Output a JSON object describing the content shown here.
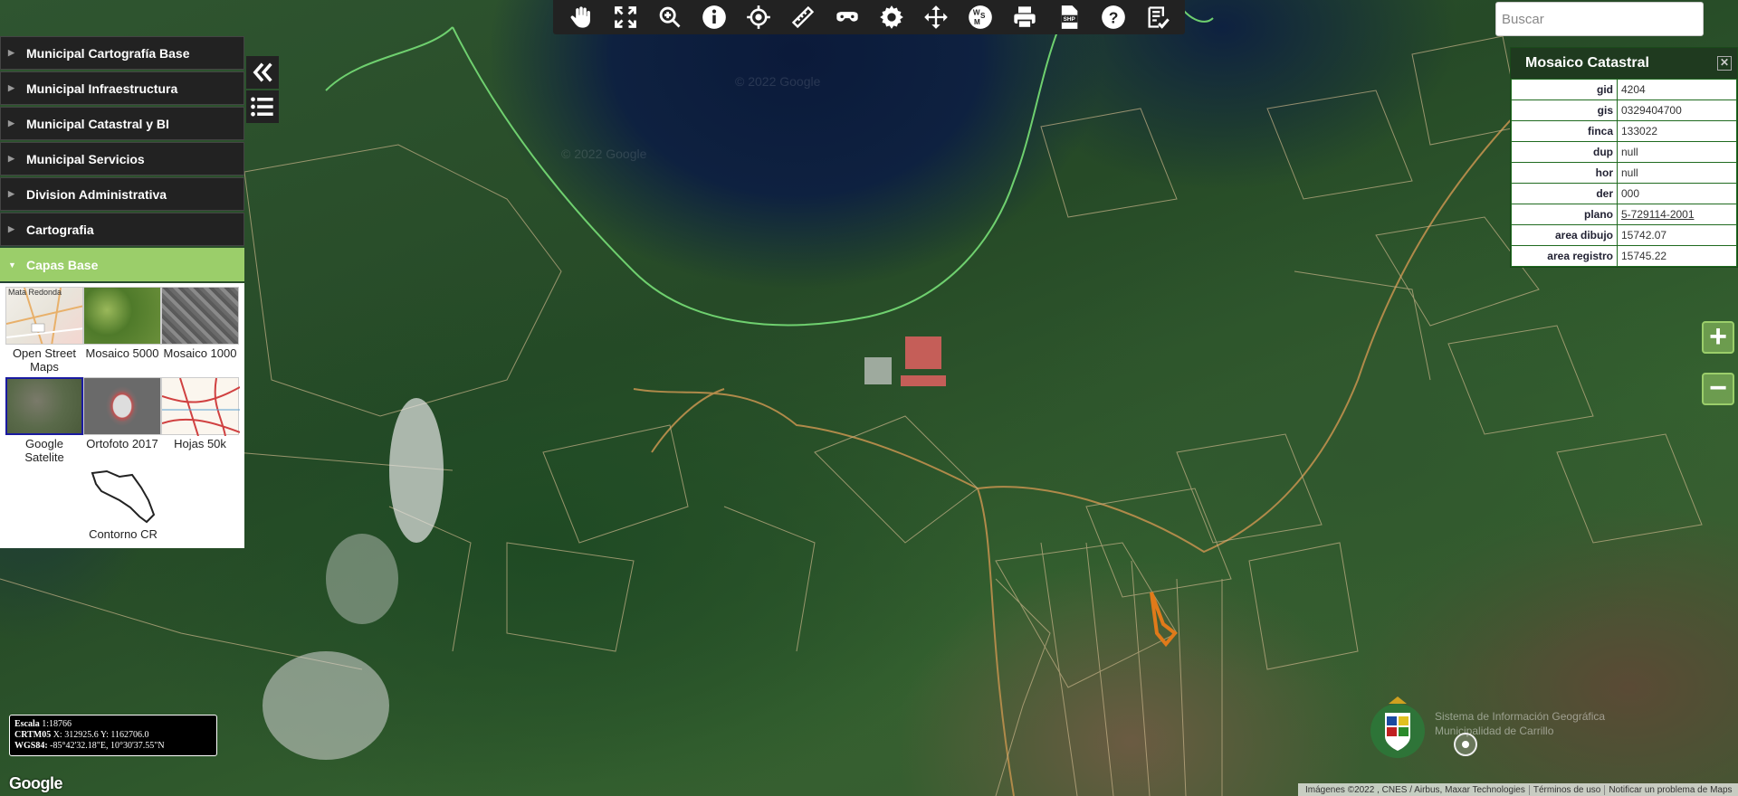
{
  "search": {
    "placeholder": "Buscar"
  },
  "toolbar": {
    "tools": [
      {
        "icon": "hand-icon"
      },
      {
        "icon": "fullscreen-icon"
      },
      {
        "icon": "zoom-in-icon"
      },
      {
        "icon": "info-icon"
      },
      {
        "icon": "crosshair-icon"
      },
      {
        "icon": "ruler-icon"
      },
      {
        "icon": "streetview-icon"
      },
      {
        "icon": "gear-icon"
      },
      {
        "icon": "move-icon"
      },
      {
        "icon": "wms-icon"
      },
      {
        "icon": "print-icon"
      },
      {
        "icon": "shp-file-icon"
      },
      {
        "icon": "help-icon"
      },
      {
        "icon": "checklist-icon"
      }
    ]
  },
  "layers": {
    "items": [
      {
        "label": "Municipal Cartografía Base"
      },
      {
        "label": "Municipal Infraestructura"
      },
      {
        "label": "Municipal Catastral y BI"
      },
      {
        "label": "Municipal Servicios"
      },
      {
        "label": "Division Administrativa"
      },
      {
        "label": "Cartografia"
      },
      {
        "label": "Capas Base"
      }
    ],
    "basemaps": [
      {
        "label": "Open Street Maps"
      },
      {
        "label": "Mosaico 5000"
      },
      {
        "label": "Mosaico 1000"
      },
      {
        "label": "Google Satelite"
      },
      {
        "label": "Ortofoto 2017"
      },
      {
        "label": "Hojas 50k"
      },
      {
        "label": "Contorno CR"
      }
    ],
    "osm_thumb_text": "Mata Redonda"
  },
  "info": {
    "title": "Mosaico Catastral",
    "rows": [
      {
        "key": "gid",
        "value": "4204"
      },
      {
        "key": "gis",
        "value": "0329404700"
      },
      {
        "key": "finca",
        "value": "133022"
      },
      {
        "key": "dup",
        "value": "null"
      },
      {
        "key": "hor",
        "value": "null"
      },
      {
        "key": "der",
        "value": "000"
      },
      {
        "key": "plano",
        "value": "5-729114-2001"
      },
      {
        "key": "area dibujo",
        "value": "15742.07"
      },
      {
        "key": "area registro",
        "value": "15745.22"
      }
    ]
  },
  "scale": {
    "escala_label": "Escala",
    "escala_value": "1:18766",
    "crtm_label": "CRTM05",
    "crtm_value": "X: 312925.6 Y: 1162706.0",
    "wgs_label": "WGS84:",
    "wgs_value": "-85°42'32.18\"E, 10°30'37.55\"N"
  },
  "footer": {
    "google": "Google",
    "attributions": [
      "Imágenes ©2022 , CNES / Airbus, Maxar Technologies",
      "Términos de uso",
      "Notificar un problema de Maps"
    ],
    "watermark_line1": "Sistema de Información Geográfica",
    "watermark_line2": "Municipalidad de Carrillo"
  },
  "map_ghost": [
    "© 2022 Google",
    "© 2022 Google"
  ],
  "colors": {
    "accent": "#9bce6a",
    "panel": "#222222",
    "info_border": "#1f6a1f",
    "parcel_highlight": "#e07a1a"
  }
}
